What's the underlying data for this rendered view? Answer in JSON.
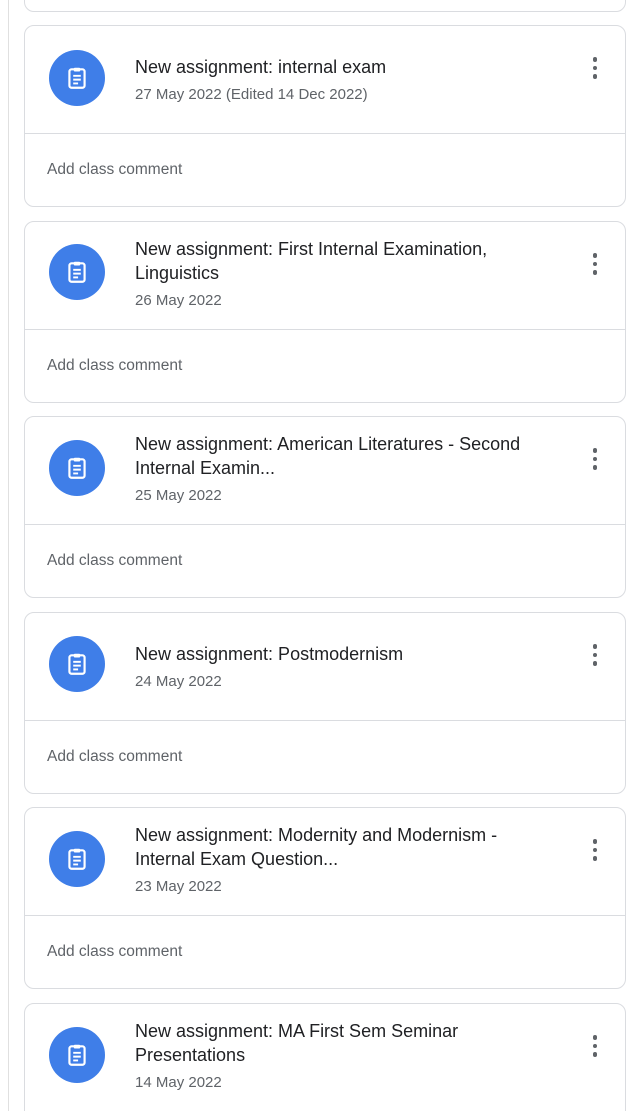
{
  "stream": {
    "comment_placeholder": "Add class comment",
    "accent_color": "#3f7ee8",
    "icon": "assignment-icon",
    "posts": [
      {
        "title": "New assignment: internal exam",
        "date": "27 May 2022 (Edited 14 Dec 2022)"
      },
      {
        "title": "New assignment: First Internal Examination, Linguistics",
        "date": "26 May 2022"
      },
      {
        "title": "New assignment: American Literatures - Second Internal Examin...",
        "date": "25 May 2022"
      },
      {
        "title": "New assignment: Postmodernism",
        "date": "24 May 2022"
      },
      {
        "title": "New assignment: Modernity and Modernism - Internal Exam Question...",
        "date": "23 May 2022"
      },
      {
        "title": "New assignment: MA First Sem Seminar Presentations",
        "date": "14 May 2022"
      }
    ]
  }
}
